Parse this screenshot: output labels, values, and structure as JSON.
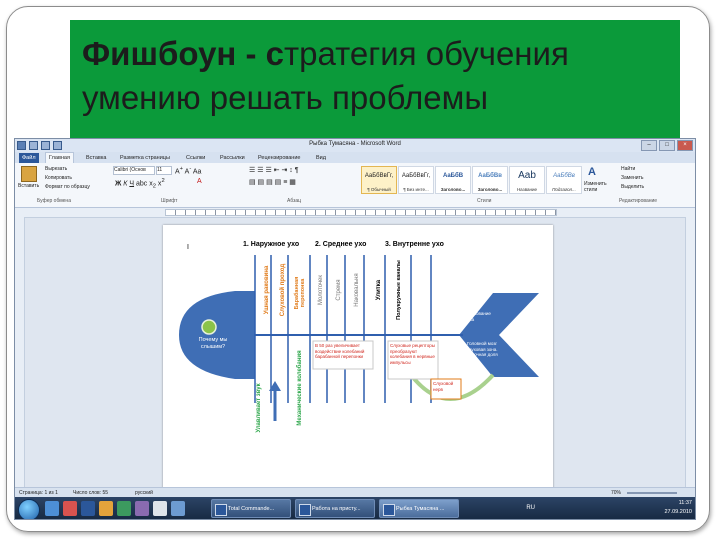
{
  "slide": {
    "title_bold": "Фишбоун - с",
    "title_rest": "тратегия обучения",
    "title_line2": "умению решать проблемы"
  },
  "word": {
    "window_title": "Рыбка Тумасяна - Microsoft Word",
    "tabs": [
      "Файл",
      "Главная",
      "Вставка",
      "Разметка страницы",
      "Ссылки",
      "Рассылки",
      "Рецензирование",
      "Вид"
    ],
    "clipboard": {
      "cut": "Вырезать",
      "copy": "Копировать",
      "format_painter": "Формат по образцу",
      "paste": "Вставить",
      "group": "Буфер обмена"
    },
    "font": {
      "name": "Calibri (Основ",
      "size": "11",
      "group": "Шрифт"
    },
    "paragraph_group": "Абзац",
    "styles": [
      {
        "preview": "АаБбВвГг,",
        "label": "¶ Обычный"
      },
      {
        "preview": "АаБбВвГг,",
        "label": "¶ Без инте..."
      },
      {
        "preview": "АаБбВ",
        "label": "Заголово..."
      },
      {
        "preview": "АаБбВв",
        "label": "Заголово..."
      },
      {
        "preview": "Aab",
        "label": "Название"
      },
      {
        "preview": "АаБбВв",
        "label": "Подзагол..."
      }
    ],
    "styles_group": "Стили",
    "change_styles": "Изменить стили",
    "editing": {
      "find": "Найти",
      "replace": "Заменить",
      "select": "Выделить",
      "group": "Редактирование"
    },
    "status": {
      "page": "Страница: 1 из 1",
      "words": "Число слов: 55",
      "language": "русский",
      "zoom": "70%"
    },
    "taskbar": {
      "items": [
        "Total Commande...",
        "Работа на присту...",
        "Рыбка Тумасяна ..."
      ],
      "lang": "RU",
      "time": "11:37",
      "date": "27.09.2010"
    }
  },
  "fishbone": {
    "cursor_mark": "I",
    "heading1": "1. Наружное ухо",
    "heading2": "2. Среднее ухо",
    "heading3": "3. Внутренне ухо",
    "head_text": "Почему мы слышим?",
    "bones_top": [
      "Ушная раковина",
      "Слуховой проход",
      "Барабанная перепонка",
      "Молоточек",
      "Стремя",
      "Наковальня",
      "Улитка",
      "Полукружные каналы"
    ],
    "bones_bottom": [
      "Улавливает звук",
      "Механические колебания"
    ],
    "box1": "В 50 раз увеличивает воздействие колебаний барабанной перепонки",
    "box2": "Слуховые рецепторы преобразуют колебания в нервные импульсы",
    "box3": "Слуховой нерв",
    "tail_top": "Образование звука",
    "tail_bottom": "Головной мозг слуховая зона. Височная доля",
    "colors": {
      "fish": "#3f6eb5",
      "heading": "#000000",
      "orange": "#e07b1a",
      "green": "#2ca64a",
      "gray": "#7a7a7a",
      "red": "#d0261d",
      "ridge": "#2f5fae"
    }
  }
}
